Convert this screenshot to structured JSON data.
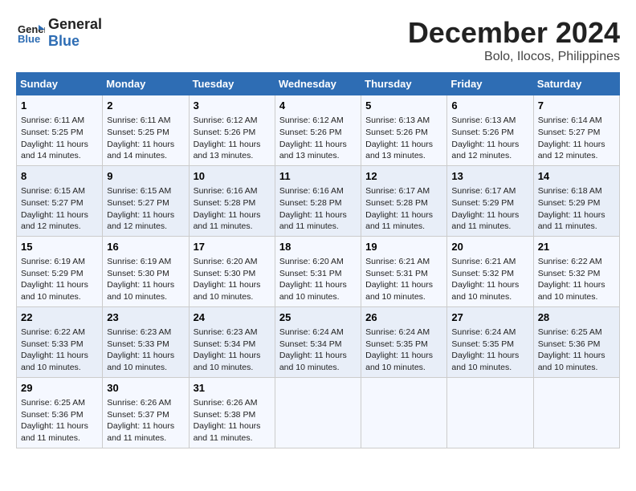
{
  "header": {
    "logo_line1": "General",
    "logo_line2": "Blue",
    "month": "December 2024",
    "location": "Bolo, Ilocos, Philippines"
  },
  "days_of_week": [
    "Sunday",
    "Monday",
    "Tuesday",
    "Wednesday",
    "Thursday",
    "Friday",
    "Saturday"
  ],
  "weeks": [
    [
      {
        "day": "1",
        "info": "Sunrise: 6:11 AM\nSunset: 5:25 PM\nDaylight: 11 hours and 14 minutes."
      },
      {
        "day": "2",
        "info": "Sunrise: 6:11 AM\nSunset: 5:25 PM\nDaylight: 11 hours and 14 minutes."
      },
      {
        "day": "3",
        "info": "Sunrise: 6:12 AM\nSunset: 5:26 PM\nDaylight: 11 hours and 13 minutes."
      },
      {
        "day": "4",
        "info": "Sunrise: 6:12 AM\nSunset: 5:26 PM\nDaylight: 11 hours and 13 minutes."
      },
      {
        "day": "5",
        "info": "Sunrise: 6:13 AM\nSunset: 5:26 PM\nDaylight: 11 hours and 13 minutes."
      },
      {
        "day": "6",
        "info": "Sunrise: 6:13 AM\nSunset: 5:26 PM\nDaylight: 11 hours and 12 minutes."
      },
      {
        "day": "7",
        "info": "Sunrise: 6:14 AM\nSunset: 5:27 PM\nDaylight: 11 hours and 12 minutes."
      }
    ],
    [
      {
        "day": "8",
        "info": "Sunrise: 6:15 AM\nSunset: 5:27 PM\nDaylight: 11 hours and 12 minutes."
      },
      {
        "day": "9",
        "info": "Sunrise: 6:15 AM\nSunset: 5:27 PM\nDaylight: 11 hours and 12 minutes."
      },
      {
        "day": "10",
        "info": "Sunrise: 6:16 AM\nSunset: 5:28 PM\nDaylight: 11 hours and 11 minutes."
      },
      {
        "day": "11",
        "info": "Sunrise: 6:16 AM\nSunset: 5:28 PM\nDaylight: 11 hours and 11 minutes."
      },
      {
        "day": "12",
        "info": "Sunrise: 6:17 AM\nSunset: 5:28 PM\nDaylight: 11 hours and 11 minutes."
      },
      {
        "day": "13",
        "info": "Sunrise: 6:17 AM\nSunset: 5:29 PM\nDaylight: 11 hours and 11 minutes."
      },
      {
        "day": "14",
        "info": "Sunrise: 6:18 AM\nSunset: 5:29 PM\nDaylight: 11 hours and 11 minutes."
      }
    ],
    [
      {
        "day": "15",
        "info": "Sunrise: 6:19 AM\nSunset: 5:29 PM\nDaylight: 11 hours and 10 minutes."
      },
      {
        "day": "16",
        "info": "Sunrise: 6:19 AM\nSunset: 5:30 PM\nDaylight: 11 hours and 10 minutes."
      },
      {
        "day": "17",
        "info": "Sunrise: 6:20 AM\nSunset: 5:30 PM\nDaylight: 11 hours and 10 minutes."
      },
      {
        "day": "18",
        "info": "Sunrise: 6:20 AM\nSunset: 5:31 PM\nDaylight: 11 hours and 10 minutes."
      },
      {
        "day": "19",
        "info": "Sunrise: 6:21 AM\nSunset: 5:31 PM\nDaylight: 11 hours and 10 minutes."
      },
      {
        "day": "20",
        "info": "Sunrise: 6:21 AM\nSunset: 5:32 PM\nDaylight: 11 hours and 10 minutes."
      },
      {
        "day": "21",
        "info": "Sunrise: 6:22 AM\nSunset: 5:32 PM\nDaylight: 11 hours and 10 minutes."
      }
    ],
    [
      {
        "day": "22",
        "info": "Sunrise: 6:22 AM\nSunset: 5:33 PM\nDaylight: 11 hours and 10 minutes."
      },
      {
        "day": "23",
        "info": "Sunrise: 6:23 AM\nSunset: 5:33 PM\nDaylight: 11 hours and 10 minutes."
      },
      {
        "day": "24",
        "info": "Sunrise: 6:23 AM\nSunset: 5:34 PM\nDaylight: 11 hours and 10 minutes."
      },
      {
        "day": "25",
        "info": "Sunrise: 6:24 AM\nSunset: 5:34 PM\nDaylight: 11 hours and 10 minutes."
      },
      {
        "day": "26",
        "info": "Sunrise: 6:24 AM\nSunset: 5:35 PM\nDaylight: 11 hours and 10 minutes."
      },
      {
        "day": "27",
        "info": "Sunrise: 6:24 AM\nSunset: 5:35 PM\nDaylight: 11 hours and 10 minutes."
      },
      {
        "day": "28",
        "info": "Sunrise: 6:25 AM\nSunset: 5:36 PM\nDaylight: 11 hours and 10 minutes."
      }
    ],
    [
      {
        "day": "29",
        "info": "Sunrise: 6:25 AM\nSunset: 5:36 PM\nDaylight: 11 hours and 11 minutes."
      },
      {
        "day": "30",
        "info": "Sunrise: 6:26 AM\nSunset: 5:37 PM\nDaylight: 11 hours and 11 minutes."
      },
      {
        "day": "31",
        "info": "Sunrise: 6:26 AM\nSunset: 5:38 PM\nDaylight: 11 hours and 11 minutes."
      },
      {
        "day": "",
        "info": ""
      },
      {
        "day": "",
        "info": ""
      },
      {
        "day": "",
        "info": ""
      },
      {
        "day": "",
        "info": ""
      }
    ]
  ]
}
